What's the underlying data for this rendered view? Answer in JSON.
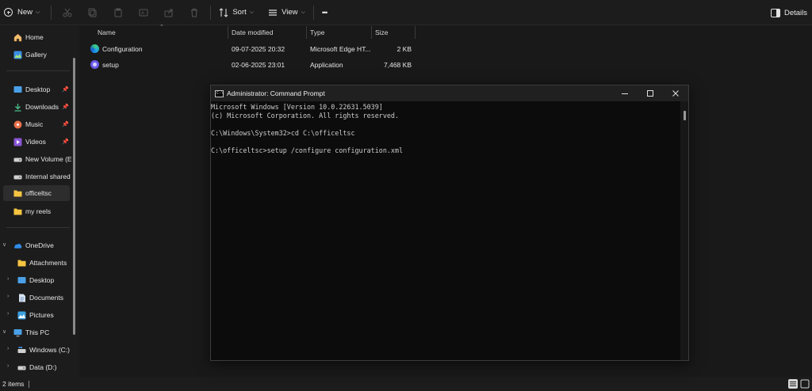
{
  "toolbar": {
    "new_label": "New",
    "sort_label": "Sort",
    "view_label": "View",
    "more_label": "•••",
    "details_label": "Details"
  },
  "sidebar": {
    "quick": [
      {
        "label": "Home",
        "icon": "home-icon"
      },
      {
        "label": "Gallery",
        "icon": "gallery-icon"
      }
    ],
    "pinned": [
      {
        "label": "Desktop",
        "icon": "desktop-icon",
        "pinned": true
      },
      {
        "label": "Downloads",
        "icon": "download-icon",
        "pinned": true
      },
      {
        "label": "Music",
        "icon": "music-icon",
        "pinned": true
      },
      {
        "label": "Videos",
        "icon": "video-icon",
        "pinned": true
      },
      {
        "label": "New Volume (E:)",
        "icon": "drive-icon"
      },
      {
        "label": "Internal shared s",
        "icon": "drive-icon"
      },
      {
        "label": "officeltsc",
        "icon": "folder-icon",
        "selected": true
      },
      {
        "label": "my reels",
        "icon": "folder-icon"
      }
    ],
    "onedrive": {
      "label": "OneDrive",
      "children": [
        {
          "label": "Attachments",
          "icon": "folder-icon"
        },
        {
          "label": "Desktop",
          "icon": "desktop-icon"
        },
        {
          "label": "Documents",
          "icon": "documents-icon"
        },
        {
          "label": "Pictures",
          "icon": "pictures-icon"
        }
      ]
    },
    "thispc": {
      "label": "This PC",
      "children": [
        {
          "label": "Windows (C:)",
          "icon": "windows-drive-icon"
        },
        {
          "label": "Data (D:)",
          "icon": "drive-icon"
        }
      ]
    }
  },
  "filelist": {
    "columns": [
      "Name",
      "Date modified",
      "Type",
      "Size"
    ],
    "rows": [
      {
        "name": "Configuration",
        "date": "09-07-2025 20:32",
        "type": "Microsoft Edge HT...",
        "size": "2 KB",
        "icon": "edge-icon"
      },
      {
        "name": "setup",
        "date": "02-06-2025 23:01",
        "type": "Application",
        "size": "7,468 KB",
        "icon": "setup-app-icon"
      }
    ]
  },
  "status": {
    "items_count": "2 items"
  },
  "cmd": {
    "title": "Administrator: Command Prompt",
    "lines": [
      "Microsoft Windows [Version 10.0.22631.5039]",
      "(c) Microsoft Corporation. All rights reserved.",
      "",
      "C:\\Windows\\System32>cd C:\\officeltsc",
      "",
      "C:\\officeltsc>setup /configure configuration.xml"
    ]
  },
  "colors": {
    "folder": "#f5c542",
    "accent_blue": "#3a8ee6",
    "cmd_text": "#cccccc"
  }
}
